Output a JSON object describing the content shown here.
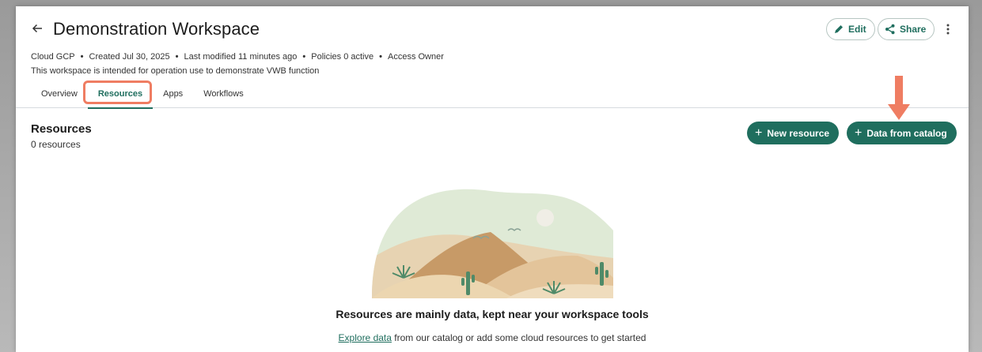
{
  "workspace": {
    "title": "Demonstration Workspace",
    "meta": [
      "Cloud GCP",
      "Created Jul 30, 2025",
      "Last modified 11 minutes ago",
      "Policies 0 active",
      "Access Owner"
    ],
    "description": "This workspace is intended for operation use to demonstrate VWB function"
  },
  "actions": {
    "edit_label": "Edit",
    "share_label": "Share"
  },
  "tabs": [
    {
      "label": "Overview",
      "active": false
    },
    {
      "label": "Resources",
      "active": true
    },
    {
      "label": "Apps",
      "active": false
    },
    {
      "label": "Workflows",
      "active": false
    }
  ],
  "resources": {
    "title": "Resources",
    "count": "0 resources",
    "new_resource_label": "New resource",
    "data_from_catalog_label": "Data from catalog"
  },
  "empty_state": {
    "title": "Resources are mainly data, kept near your workspace tools",
    "link_text": "Explore data",
    "rest_text": " from our catalog or add some cloud resources to get started"
  },
  "colors": {
    "accent": "#1f6e5e",
    "highlight": "#ef7d62"
  }
}
